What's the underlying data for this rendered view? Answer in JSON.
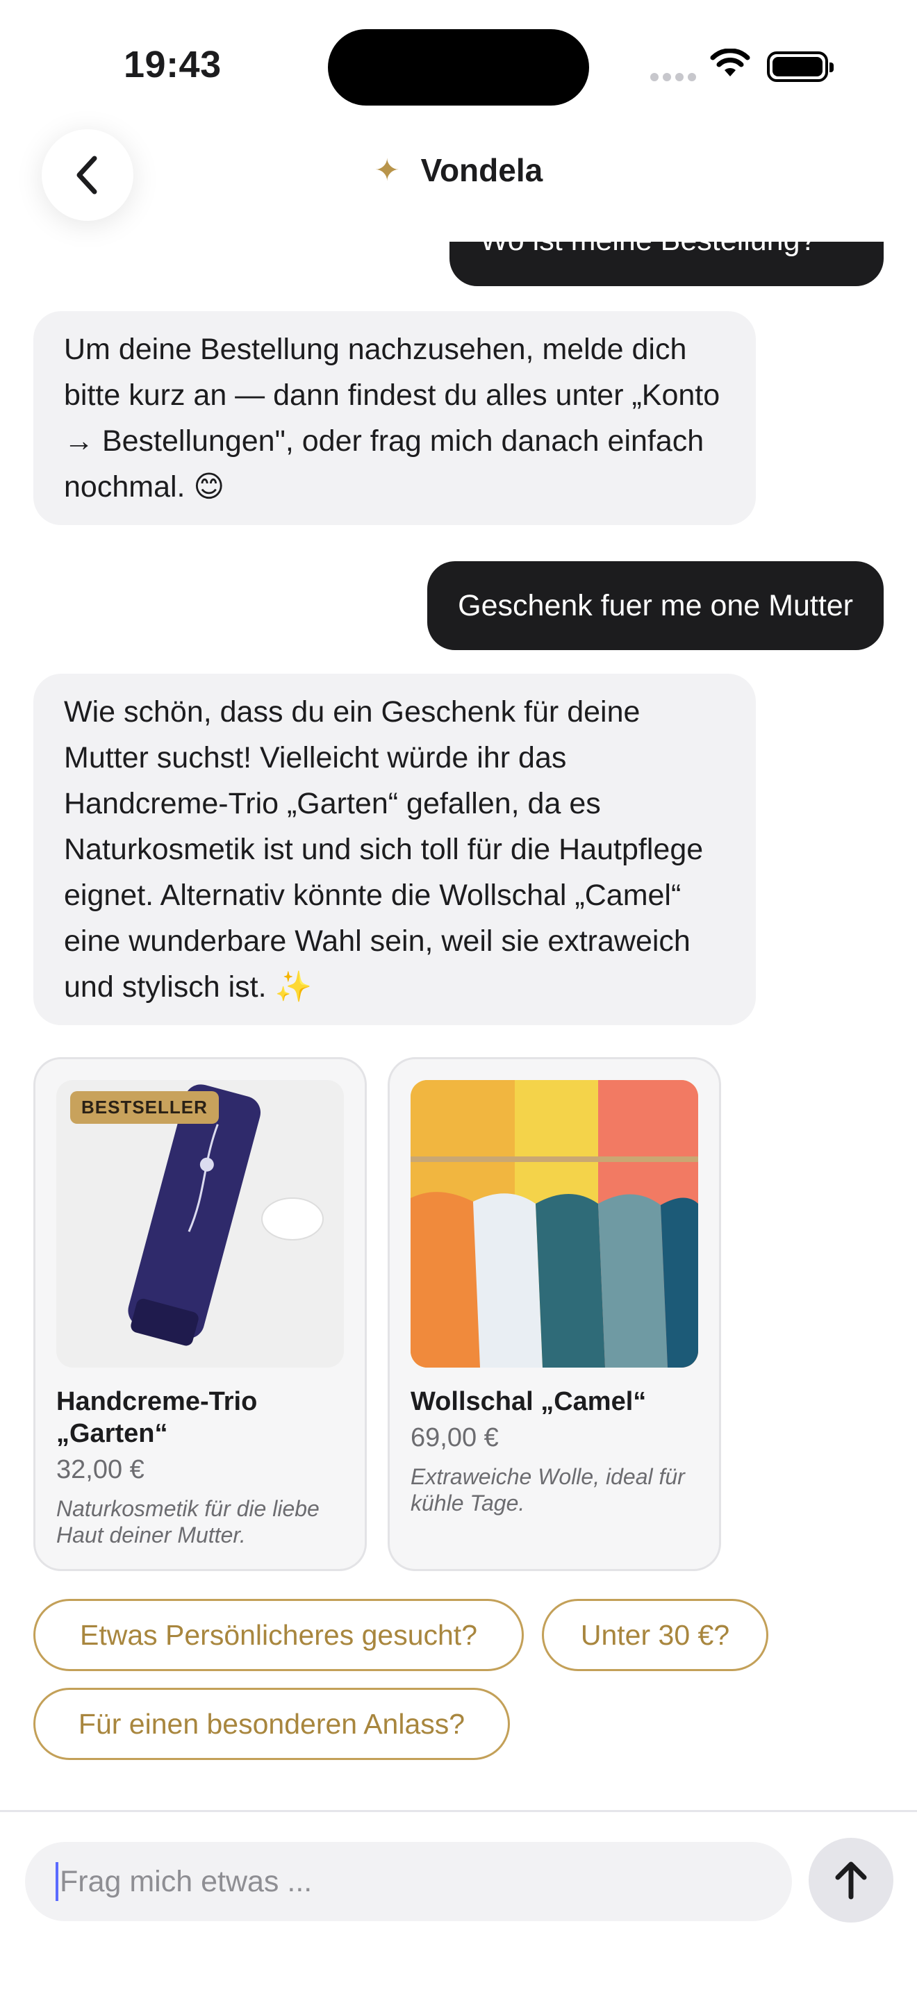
{
  "status_bar": {
    "time": "19:43"
  },
  "header": {
    "title": "Vondela",
    "sparkle_glyph": "✦"
  },
  "messages": [
    {
      "role": "user",
      "text": "Wo ist meine Bestellung?"
    },
    {
      "role": "assistant",
      "text": "Um deine Bestellung nachzusehen, melde dich bitte kurz an — dann findest du alles unter „Konto → Bestellungen\", oder frag mich danach einfach nochmal. 😊"
    },
    {
      "role": "user",
      "text": "Geschenk fuer me one Mutter"
    },
    {
      "role": "assistant",
      "text": "Wie schön, dass du ein Geschenk für deine Mutter suchst! Vielleicht würde ihr das Handcreme-Trio „Garten“ gefallen, da es Naturkosmetik ist und sich toll für die Hautpflege eignet. Alternativ könnte die Wollschal „Camel“ eine wunderbare Wahl sein, weil sie extraweich und stylisch ist. ✨"
    }
  ],
  "products": [
    {
      "badge": "BESTSELLER",
      "title": "Handcreme-Trio „Garten“",
      "price": "32,00 €",
      "description": "Naturkosmetik für die liebe Haut deiner Mutter."
    },
    {
      "title": "Wollschal „Camel“",
      "price": "69,00 €",
      "description": "Extraweiche Wolle, ideal für kühle Tage."
    }
  ],
  "suggestions": [
    "Etwas Persönlicheres gesucht?",
    "Unter 30 €?",
    "Für einen besonderen Anlass?"
  ],
  "composer": {
    "placeholder": "Frag mich etwas ..."
  },
  "icons": {
    "back": "chevron-left-icon",
    "send": "arrow-up-icon",
    "wifi": "wifi-icon",
    "battery": "battery-icon"
  },
  "colors": {
    "accent": "#b8944a",
    "user_bubble": "#1c1c1e",
    "bot_bubble": "#f2f2f4"
  }
}
